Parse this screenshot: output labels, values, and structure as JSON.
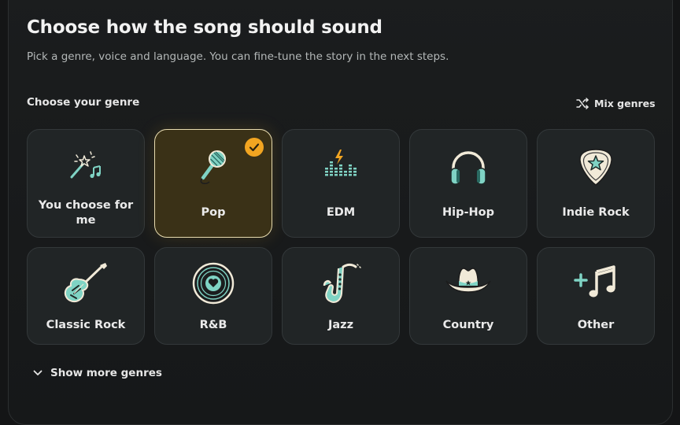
{
  "header": {
    "title": "Choose how the song should sound",
    "subtitle": "Pick a genre, voice and language. You can fine-tune the story in the next steps."
  },
  "genre_section": {
    "label": "Choose your genre",
    "mix_label": "Mix genres"
  },
  "genres": [
    {
      "label": "You choose for me",
      "icon": "magic-wand-music-icon",
      "selected": false
    },
    {
      "label": "Pop",
      "icon": "microphone-icon",
      "selected": true
    },
    {
      "label": "EDM",
      "icon": "equalizer-bolt-icon",
      "selected": false
    },
    {
      "label": "Hip-Hop",
      "icon": "headphones-icon",
      "selected": false
    },
    {
      "label": "Indie Rock",
      "icon": "guitar-pick-star-icon",
      "selected": false
    },
    {
      "label": "Classic Rock",
      "icon": "electric-guitar-icon",
      "selected": false
    },
    {
      "label": "R&B",
      "icon": "vinyl-heart-icon",
      "selected": false
    },
    {
      "label": "Jazz",
      "icon": "saxophone-icon",
      "selected": false
    },
    {
      "label": "Country",
      "icon": "cowboy-hat-icon",
      "selected": false
    },
    {
      "label": "Other",
      "icon": "plus-music-note-icon",
      "selected": false
    }
  ],
  "show_more": {
    "label": "Show more genres"
  },
  "colors": {
    "accent": "#f2a521",
    "teal": "#7fd3c4",
    "cream": "#f1ead8"
  }
}
